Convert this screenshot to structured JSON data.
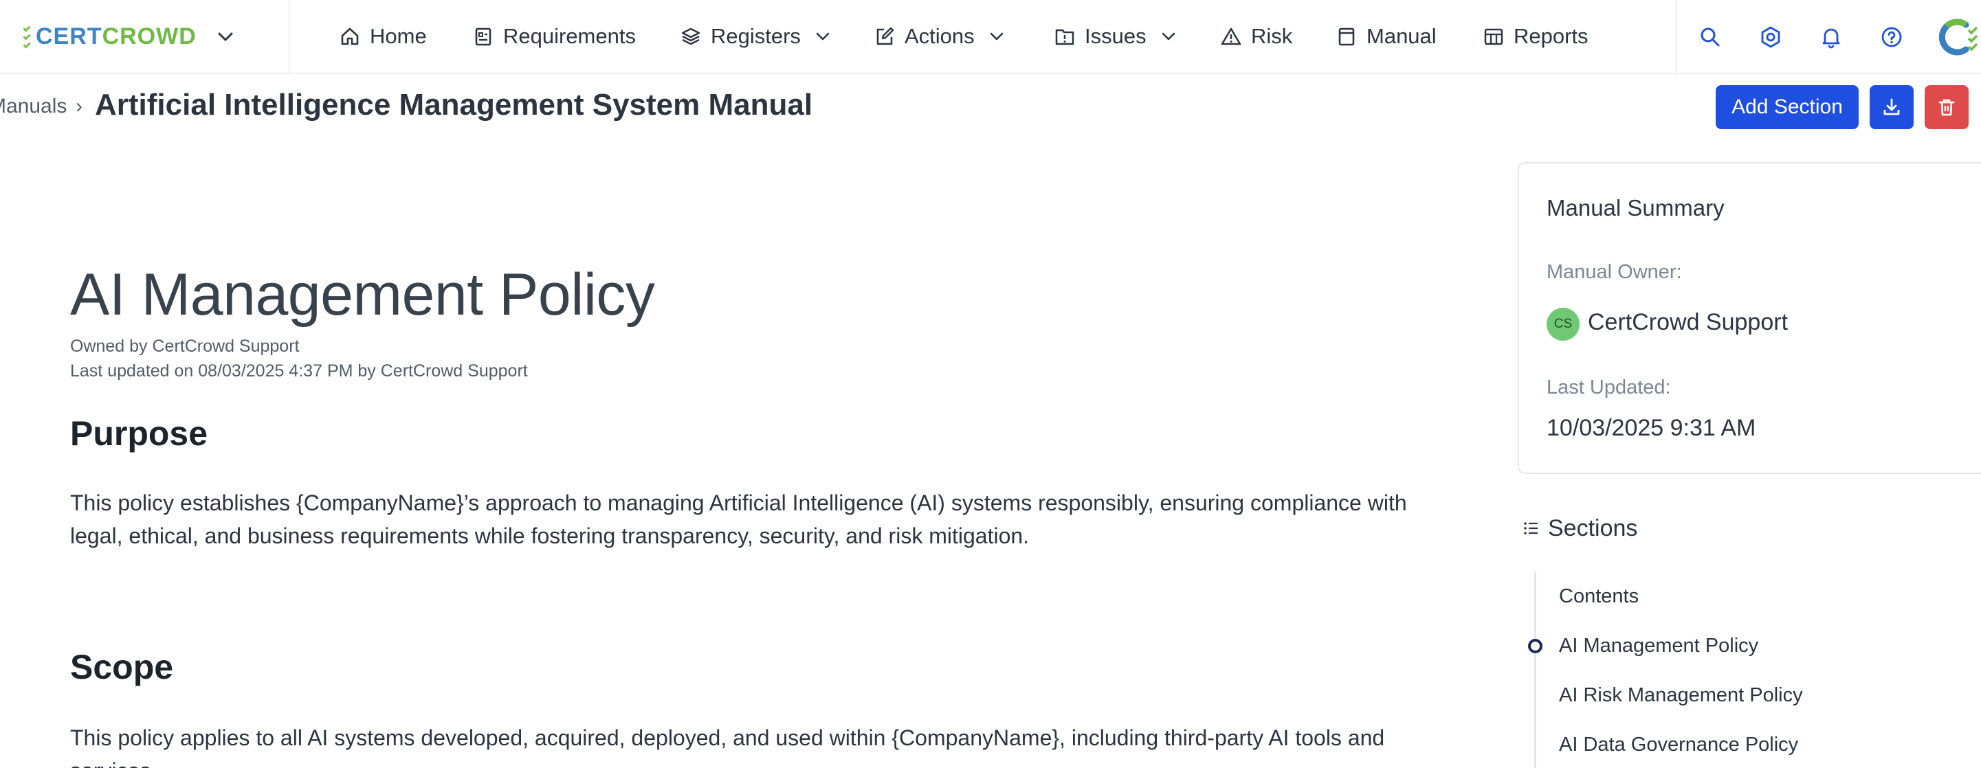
{
  "brand": {
    "part1": "CERT",
    "part2": "CROWD"
  },
  "nav": {
    "home": "Home",
    "requirements": "Requirements",
    "registers": "Registers",
    "actions": "Actions",
    "issues": "Issues",
    "risk": "Risk",
    "manual": "Manual",
    "reports": "Reports"
  },
  "icons": {
    "search": "search-icon",
    "settings": "gear-icon",
    "notifications": "bell-icon",
    "help": "help-circle-icon"
  },
  "header": {
    "breadcrumb_parent": "Manuals",
    "breadcrumb_separator": "›",
    "title": "Artificial Intelligence Management System Manual",
    "add_section_label": "Add Section"
  },
  "document": {
    "title": "AI Management Policy",
    "owned_by": "Owned by CertCrowd Support",
    "last_updated": "Last updated on 08/03/2025 4:37 PM by CertCrowd Support",
    "sections": [
      {
        "heading": "Purpose",
        "body": "This policy establishes {CompanyName}’s approach to managing Artificial Intelligence (AI) systems responsibly, ensuring compliance with legal, ethical, and business requirements while fostering transparency, security, and risk mitigation."
      },
      {
        "heading": "Scope",
        "body": "This policy applies to all AI systems developed, acquired, deployed, and used within {CompanyName}, including third-party AI tools and services."
      }
    ]
  },
  "summary": {
    "title": "Manual Summary",
    "owner_label": "Manual Owner:",
    "owner_initials": "CS",
    "owner_name": "CertCrowd Support",
    "updated_label": "Last Updated:",
    "updated_value": "10/03/2025 9:31 AM"
  },
  "sections_nav": {
    "title": "Sections",
    "items": [
      "Contents",
      "AI Management Policy",
      "AI Risk Management Policy",
      "AI Data Governance Policy"
    ],
    "active_index": 1
  },
  "colors": {
    "primary": "#1f4fe0",
    "danger": "#df4b4b",
    "brand_blue": "#3d86c6",
    "brand_green": "#6fba44",
    "avatar_green": "#6fc873"
  }
}
